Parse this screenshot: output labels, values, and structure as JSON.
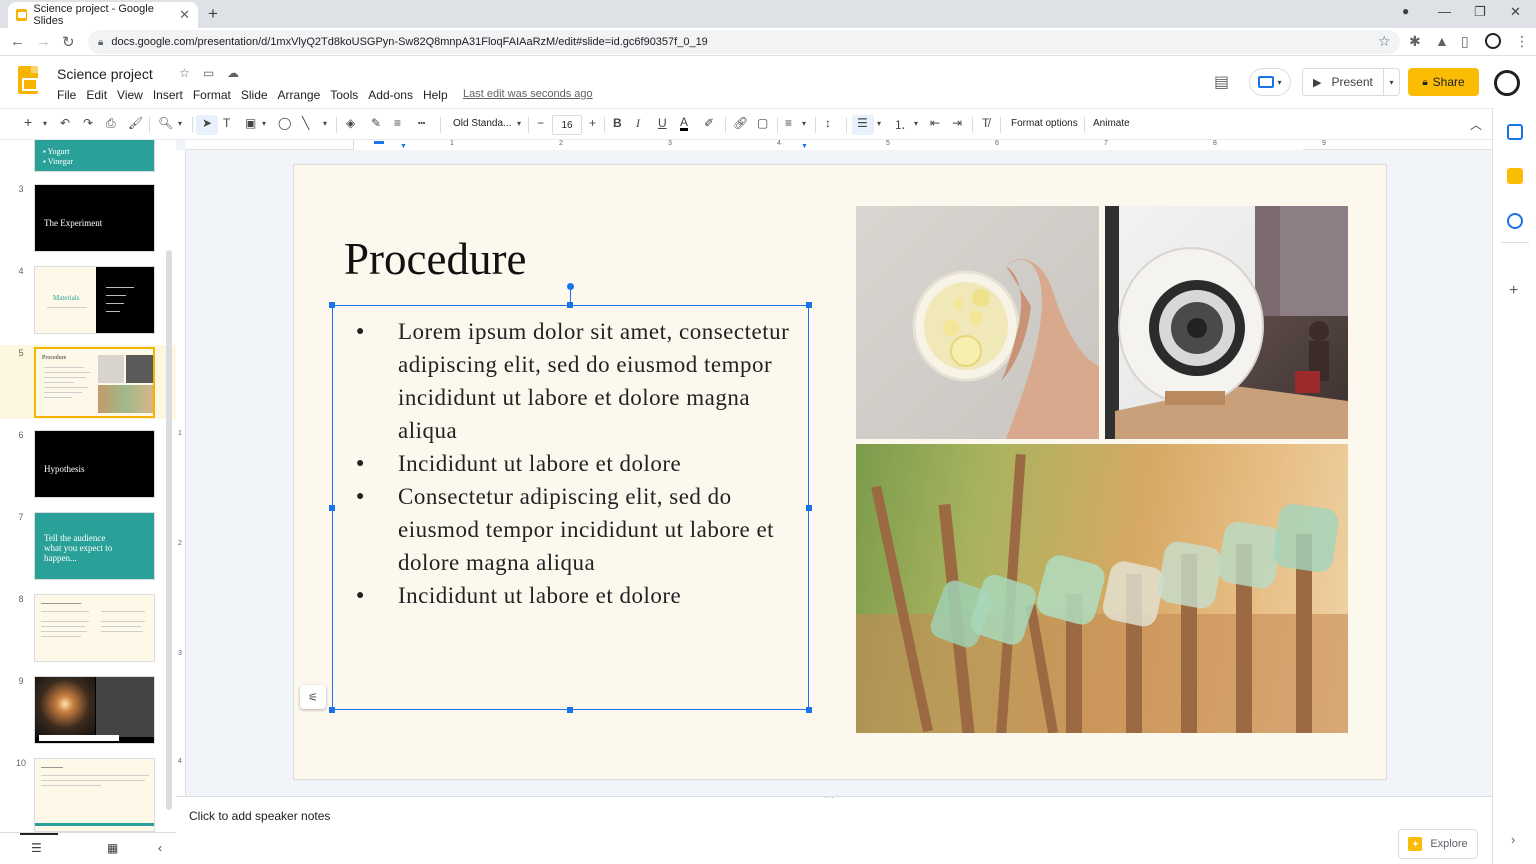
{
  "browser": {
    "tab_title": "Science project - Google Slides",
    "tab_close": "✕",
    "new_tab": "+",
    "url": "docs.google.com/presentation/d/1mxVlyQ2Td8koUSGPyn-Sw82Q8mnpA31FloqFAIAaRzM/edit#slide=id.gc6f90357f_0_19"
  },
  "doc": {
    "title": "Science project",
    "menus": [
      "File",
      "Edit",
      "View",
      "Insert",
      "Format",
      "Slide",
      "Arrange",
      "Tools",
      "Add-ons",
      "Help"
    ],
    "last_edit": "Last edit was seconds ago",
    "present_label": "Present",
    "share_label": "Share"
  },
  "toolbar": {
    "font_name": "Old Standa...",
    "font_size": "16",
    "format_options": "Format options",
    "animate": "Animate"
  },
  "filmstrip": {
    "numbers": [
      "3",
      "4",
      "5",
      "6",
      "7",
      "8",
      "9",
      "10"
    ],
    "slide2_items": [
      "Yogurt",
      "Vinegar"
    ],
    "slide3_title": "The Experiment",
    "slide4_title": "Materials",
    "slide6_title": "Hypothesis",
    "slide7_title": "Tell the audience what you expect to happen...",
    "selected_index": 5
  },
  "slide": {
    "title": "Procedure",
    "bullets": [
      "Lorem ipsum dolor sit amet, consectetur adipiscing elit, sed do eiusmod tempor incididunt ut labore et dolore magna aliqua",
      "Incididunt ut labore et dolore",
      "Consectetur adipiscing elit, sed do eiusmod tempor incididunt ut labore et dolore magna aliqua",
      "Incididunt ut labore et dolore"
    ]
  },
  "ruler": {
    "top_ticks": [
      "1",
      "2",
      "3",
      "4",
      "5",
      "6",
      "7",
      "8",
      "9"
    ],
    "left_ticks": [
      "1",
      "2",
      "3",
      "4"
    ]
  },
  "notes": {
    "placeholder": "Click to add speaker notes",
    "explore_label": "Explore"
  },
  "colors": {
    "accent_yellow": "#fbbc04",
    "selection_blue": "#1a73e8",
    "slide_bg": "#fdf8ee",
    "teal": "#2aa198"
  }
}
